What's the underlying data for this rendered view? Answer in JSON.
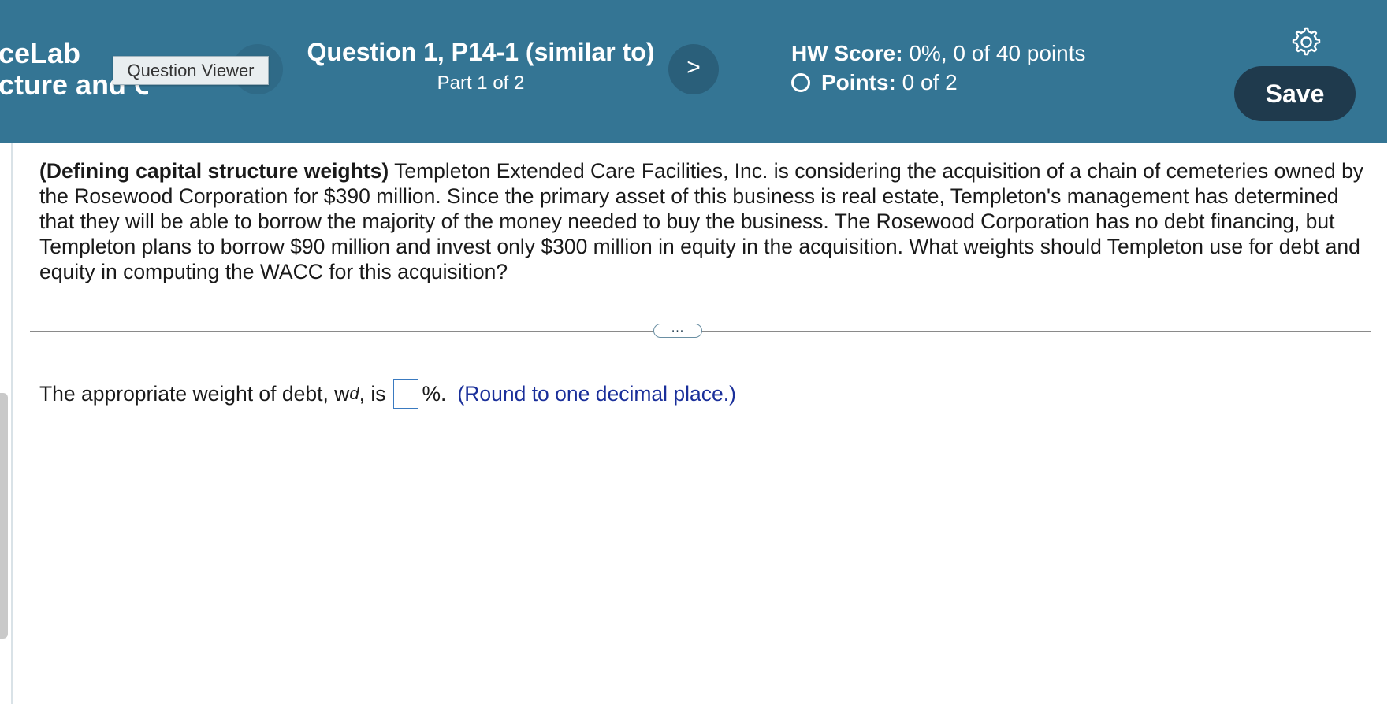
{
  "header": {
    "course_line1": "ceLab",
    "course_line2": "cture and C",
    "question_viewer_tooltip": "Question Viewer",
    "question_title": "Question 1, P14-1 (similar to)",
    "question_part": "Part 1 of 2",
    "next_label": ">",
    "hw_score_label": "HW Score:",
    "hw_score_value": "0%, 0 of 40 points",
    "points_label": "Points:",
    "points_value": "0 of 2",
    "save_label": "Save",
    "icons": {
      "settings": "gear-icon",
      "next": "chevron-right-icon",
      "status": "empty-circle-icon"
    }
  },
  "problem": {
    "lead": "(Defining capital structure weights)",
    "text": "Templeton Extended Care Facilities, Inc. is considering the acquisition of a chain of cemeteries owned by the Rosewood Corporation for $390 million. Since the primary asset of this business is real estate, Templeton's management has determined that they will be able to borrow the majority of the money needed to buy the business. The Rosewood Corporation has no debt financing, but Templeton plans to borrow $90 million and invest only $300 million in equity in the acquisition. What weights should Templeton use for debt and equity in computing the WACC for this acquisition?"
  },
  "divider": {
    "more_label": "..."
  },
  "answer": {
    "prefix": "The appropriate weight of debt, w",
    "subscript": "d",
    "suffix_before_input": ", is",
    "input_value": "",
    "after_input": "%.",
    "hint": "(Round to one decimal place.)"
  },
  "colors": {
    "header_bg": "#347594",
    "save_bg": "#1f3a4d",
    "hint_text": "#1a2f9a"
  }
}
